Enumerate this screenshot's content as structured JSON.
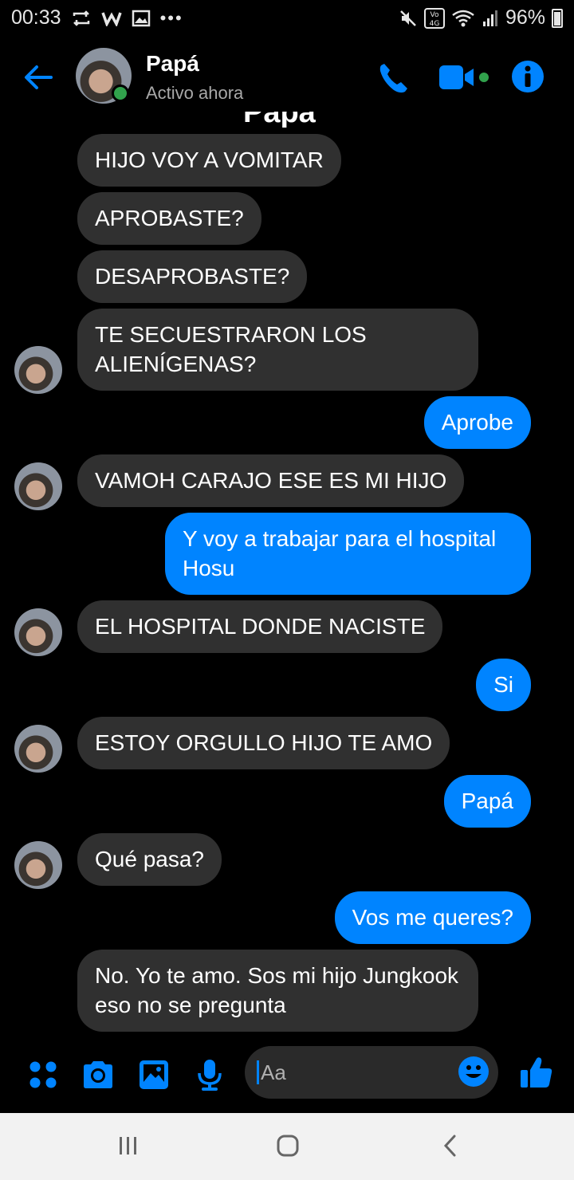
{
  "status_bar": {
    "time": "00:33",
    "battery": "96%",
    "network": "VoLTE 4G"
  },
  "header": {
    "contact_name": "Papá",
    "contact_status": "Activo ahora",
    "icons": [
      "back-arrow-icon",
      "phone-icon",
      "video-camera-icon",
      "info-icon"
    ]
  },
  "cut_title": "Papá",
  "messages": [
    {
      "side": "in",
      "text": "HIJO VOY A VOMITAR"
    },
    {
      "side": "in",
      "text": "APROBASTE?"
    },
    {
      "side": "in",
      "text": "DESAPROBASTE?"
    },
    {
      "side": "in",
      "text": "TE SECUESTRARON LOS ALIENÍGENAS?"
    },
    {
      "side": "out",
      "text": "Aprobe"
    },
    {
      "side": "in",
      "text": "VAMOH CARAJO ESE ES MI HIJO"
    },
    {
      "side": "out",
      "text": "Y voy a trabajar para el hospital Hosu"
    },
    {
      "side": "in",
      "text": "EL HOSPITAL DONDE NACISTE"
    },
    {
      "side": "out",
      "text": "Si"
    },
    {
      "side": "in",
      "text": "ESTOY ORGULLO HIJO TE AMO"
    },
    {
      "side": "out",
      "text": "Papá"
    },
    {
      "side": "in",
      "text": "Qué pasa?"
    },
    {
      "side": "out",
      "text": "Vos me queres?"
    },
    {
      "side": "in",
      "text": "No. Yo te amo. Sos mi hijo Jungkook eso no se pregunta"
    }
  ],
  "composer": {
    "placeholder": "Aa",
    "icons": [
      "menu-dots-icon",
      "camera-icon",
      "gallery-icon",
      "microphone-icon",
      "emoji-icon",
      "thumbs-up-icon"
    ]
  },
  "colors": {
    "accent": "#0084ff",
    "incoming_bubble": "#303030",
    "online": "#31a24c"
  }
}
